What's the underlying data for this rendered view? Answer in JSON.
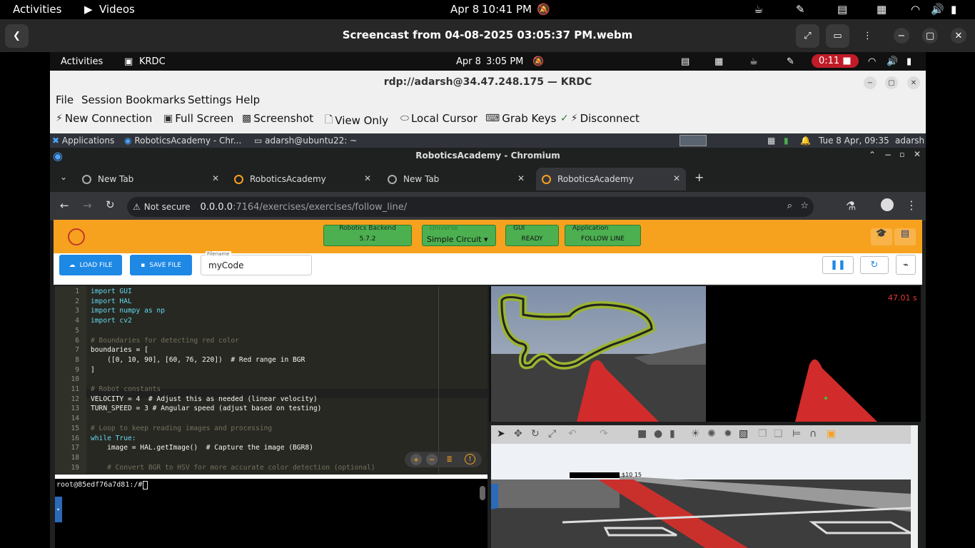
{
  "topbar": {
    "activities": "Activities",
    "app": "Videos",
    "date": "Apr 8",
    "time": "10:41 PM"
  },
  "video": {
    "title": "Screencast from 04-08-2025 03:05:37 PM.webm"
  },
  "inner_bar": {
    "activities": "Activities",
    "app": "KRDC",
    "date": "Apr 8",
    "time": "3:05 PM",
    "rec": "0:11"
  },
  "krdc": {
    "title": "rdp://adarsh@34.47.248.175 — KRDC",
    "menu": [
      "File",
      "Session",
      "Bookmarks",
      "Settings",
      "Help"
    ],
    "toolbar": [
      "New Connection",
      "Full Screen",
      "Screenshot",
      "View Only",
      "Local Cursor",
      "Grab Keys",
      "Disconnect"
    ]
  },
  "xfce": {
    "applications": "Applications",
    "task1": "RoboticsAcademy - Chr...",
    "task2": "adarsh@ubuntu22: ~",
    "clock": "Tue  8 Apr, 09:35",
    "user": "adarsh"
  },
  "chrome": {
    "title": "RoboticsAcademy - Chromium",
    "tabs": [
      "New Tab",
      "RoboticsAcademy",
      "New Tab",
      "RoboticsAcademy"
    ],
    "security": "Not secure",
    "url_host": "0.0.0.0",
    "url_rest": ":7164/exercises/exercises/follow_line/"
  },
  "app": {
    "backend_label": "Robotics Backend",
    "backend_value": "5.7.2",
    "universe_label": "Universe",
    "universe_value": "Simple Circuit",
    "gui_label": "GUI",
    "gui_value": "READY",
    "application_label": "Application",
    "application_value": "FOLLOW LINE",
    "load_file": "LOAD FILE",
    "save_file": "SAVE FILE",
    "filename_label": "Filename",
    "filename_value": "myCode",
    "timer": "47.01 s",
    "sim_text": "$10 15",
    "terminal_prompt": "root@85edf76a7d81:/# "
  },
  "code_lines": [
    {
      "n": "1",
      "t": "import GUI"
    },
    {
      "n": "2",
      "t": "import HAL"
    },
    {
      "n": "3",
      "t": "import numpy as np"
    },
    {
      "n": "4",
      "t": "import cv2"
    },
    {
      "n": "5",
      "t": ""
    },
    {
      "n": "6",
      "t": "# Boundaries for detecting red color"
    },
    {
      "n": "7",
      "t": "boundaries = ["
    },
    {
      "n": "8",
      "t": "    ([0, 10, 90], [60, 76, 220])  # Red range in BGR"
    },
    {
      "n": "9",
      "t": "]"
    },
    {
      "n": "10",
      "t": ""
    },
    {
      "n": "11",
      "t": "# Robot constants"
    },
    {
      "n": "12",
      "t": "VELOCITY = 4  # Adjust this as needed (linear velocity)"
    },
    {
      "n": "13",
      "t": "TURN_SPEED = 3 # Angular speed (adjust based on testing)"
    },
    {
      "n": "14",
      "t": ""
    },
    {
      "n": "15",
      "t": "# Loop to keep reading images and processing"
    },
    {
      "n": "16",
      "t": "while True:"
    },
    {
      "n": "17",
      "t": "    image = HAL.getImage()  # Capture the image (BGR8)"
    },
    {
      "n": "18",
      "t": ""
    },
    {
      "n": "19",
      "t": "    # Convert BGR to HSV for more accurate color detection (optional)"
    }
  ]
}
